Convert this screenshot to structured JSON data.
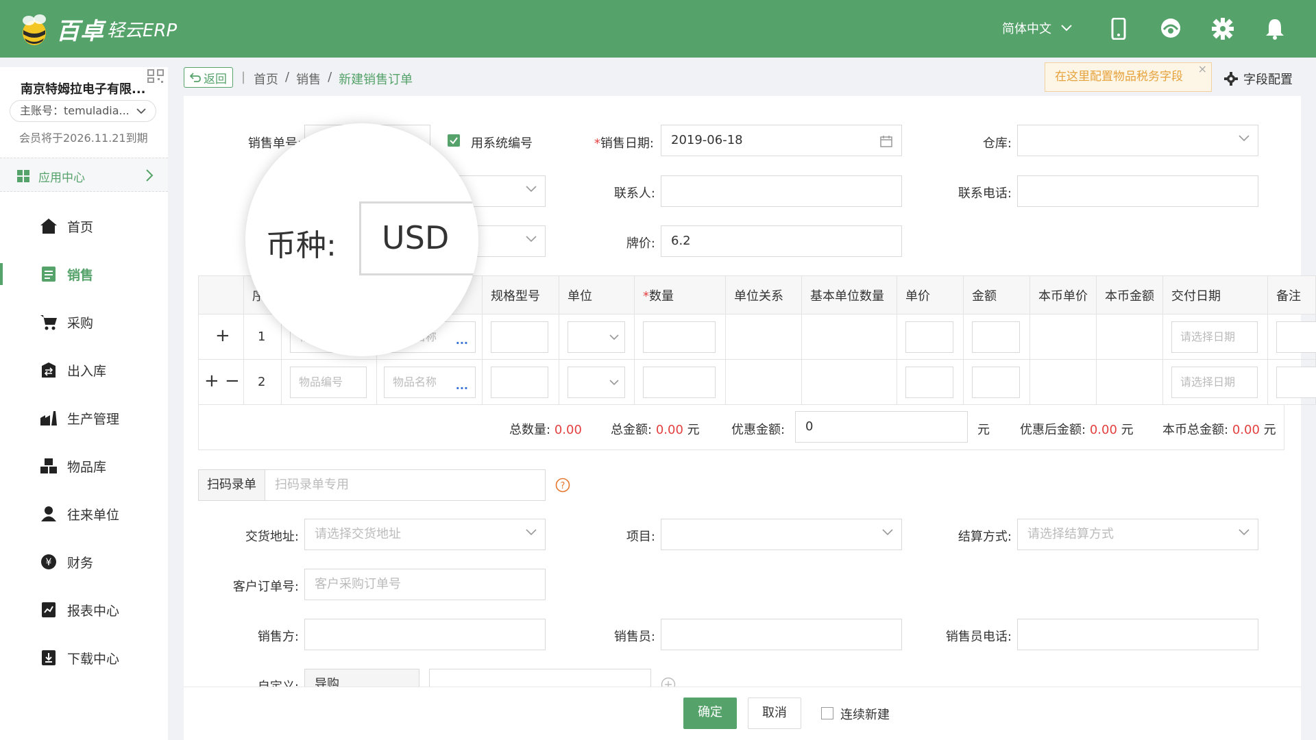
{
  "topbar": {
    "logo_brand": "百卓",
    "logo_product": "轻云ERP",
    "language": "简体中文"
  },
  "sidebar": {
    "company_name": "南京特姆拉电子有限...",
    "account": "主账号：temuladia...",
    "membership": "会员将于2026.11.21到期",
    "app_center": "应用中心",
    "items": [
      {
        "label": "首页",
        "icon": "home-icon"
      },
      {
        "label": "销售",
        "icon": "sales-icon",
        "active": true
      },
      {
        "label": "采购",
        "icon": "cart-icon"
      },
      {
        "label": "出入库",
        "icon": "inout-icon"
      },
      {
        "label": "生产管理",
        "icon": "production-icon"
      },
      {
        "label": "物品库",
        "icon": "warehouse-icon"
      },
      {
        "label": "往来单位",
        "icon": "contact-icon"
      },
      {
        "label": "财务",
        "icon": "finance-icon"
      },
      {
        "label": "报表中心",
        "icon": "report-icon"
      },
      {
        "label": "下载中心",
        "icon": "download-icon"
      }
    ]
  },
  "breadcrumb": {
    "back": "返回",
    "items": [
      "首页",
      "销售",
      "新建销售订单"
    ],
    "tooltip": "在这里配置物品税务字段",
    "field_config": "字段配置"
  },
  "form": {
    "order_no_label": "销售单号:",
    "use_system_no": "用系统编号",
    "sale_date_label": "销售日期:",
    "sale_date_value": "2019-06-18",
    "warehouse_label": "仓库:",
    "contact_label": "联系人:",
    "phone_label": "联系电话:",
    "price_label": "牌价:",
    "price_value": "6.2",
    "currency_label": "币种:",
    "currency_value": "USD"
  },
  "table": {
    "headers": [
      "序",
      "规格型号",
      "单位",
      "数量",
      "单位关系",
      "基本单位数量",
      "单价",
      "金额",
      "本币单价",
      "本币金额",
      "交付日期",
      "备注"
    ],
    "rows": [
      {
        "no": "1",
        "item_code": "物品编号",
        "item_name": "物品名称",
        "date_ph": "请选择日期"
      },
      {
        "no": "2",
        "item_code": "物品编号",
        "item_name": "物品名称",
        "date_ph": "请选择日期"
      }
    ],
    "total_qty_label": "总数量:",
    "total_qty": "0.00",
    "total_amount_label": "总金额:",
    "total_amount": "0.00",
    "yuan": "元",
    "discount_label": "优惠金额:",
    "discount_value": "0",
    "after_discount_label": "优惠后金额:",
    "after_discount": "0.00",
    "local_total_label": "本币总金额:",
    "local_total": "0.00"
  },
  "scan": {
    "label": "扫码录单",
    "placeholder": "扫码录单专用"
  },
  "extra": {
    "delivery_label": "交货地址:",
    "delivery_ph": "请选择交货地址",
    "project_label": "项目:",
    "settle_label": "结算方式:",
    "settle_ph": "请选择结算方式",
    "customer_po_label": "客户订单号:",
    "customer_po_ph": "客户采购订单号",
    "seller_label": "销售方:",
    "salesman_label": "销售员:",
    "salesman_phone_label": "销售员电话:",
    "custom_label": "自定义:",
    "custom_value": "导购"
  },
  "footer": {
    "confirm": "确定",
    "cancel": "取消",
    "continue_new": "连续新建"
  },
  "colors": {
    "brand": "#55a26a",
    "accent_red": "#e34040",
    "link_blue": "#3b74d6"
  }
}
